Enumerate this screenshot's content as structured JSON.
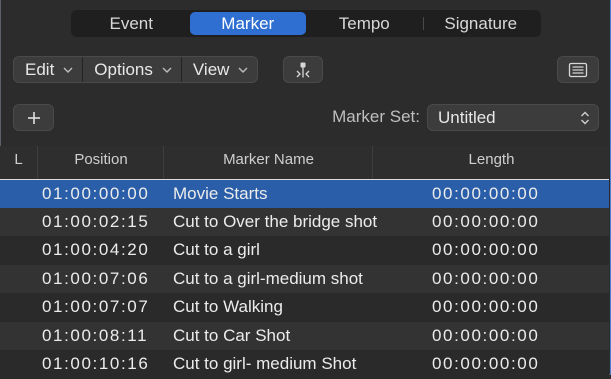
{
  "tabs": [
    {
      "label": "Event",
      "active": false
    },
    {
      "label": "Marker",
      "active": true
    },
    {
      "label": "Tempo",
      "active": false
    },
    {
      "label": "Signature",
      "active": false
    }
  ],
  "toolbar": {
    "edit_label": "Edit",
    "options_label": "Options",
    "view_label": "View",
    "filter_icon": "marker-filter-icon",
    "list_icon": "list-view-icon"
  },
  "marker_set": {
    "add_icon": "plus-icon",
    "label": "Marker Set:",
    "value": "Untitled"
  },
  "table": {
    "headers": {
      "lock": "L",
      "position": "Position",
      "name": "Marker Name",
      "length": "Length"
    },
    "rows": [
      {
        "position": "01:00:00:00",
        "name": "Movie Starts",
        "length": "00:00:00:00",
        "selected": true
      },
      {
        "position": "01:00:02:15",
        "name": "Cut to Over the bridge shot",
        "length": "00:00:00:00",
        "selected": false
      },
      {
        "position": "01:00:04:20",
        "name": "Cut to a girl",
        "length": "00:00:00:00",
        "selected": false
      },
      {
        "position": "01:00:07:06",
        "name": "Cut to a girl-medium shot",
        "length": "00:00:00:00",
        "selected": false
      },
      {
        "position": "01:00:07:07",
        "name": "Cut to Walking",
        "length": "00:00:00:00",
        "selected": false
      },
      {
        "position": "01:00:08:11",
        "name": "Cut to Car Shot",
        "length": "00:00:00:00",
        "selected": false
      },
      {
        "position": "01:00:10:16",
        "name": "Cut to girl- medium Shot",
        "length": "00:00:00:00",
        "selected": false
      }
    ]
  },
  "colors": {
    "accent": "#2f6fd1",
    "selection": "#2a5ea8",
    "background": "#2c2c2c"
  }
}
